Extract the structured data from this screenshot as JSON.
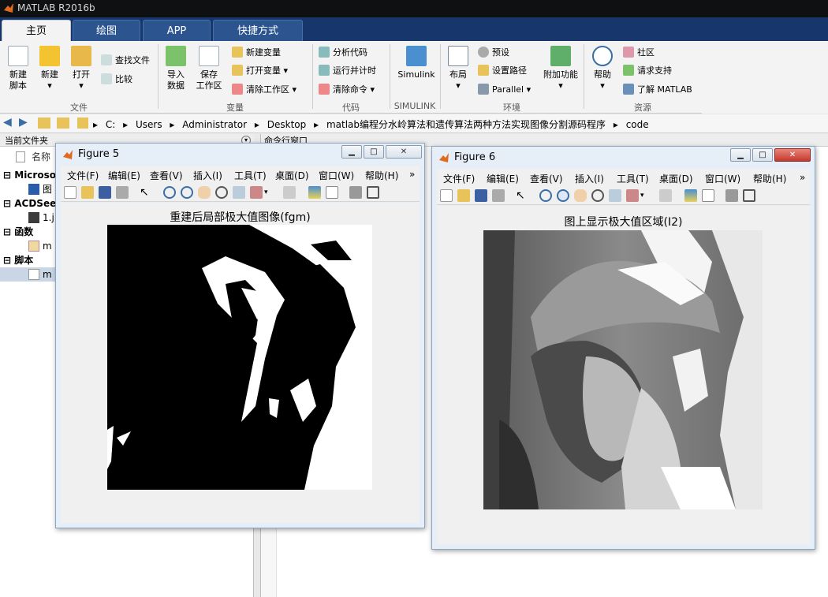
{
  "app": {
    "title": "MATLAB R2016b"
  },
  "tabs": [
    {
      "label": "主页",
      "active": true
    },
    {
      "label": "绘图",
      "active": false
    },
    {
      "label": "APP",
      "active": false
    },
    {
      "label": "快捷方式",
      "active": false
    }
  ],
  "ribbon": {
    "file": {
      "new_script": "新建\n脚本",
      "new": "新建",
      "open": "打开",
      "find_files": "查找文件",
      "compare": "比较",
      "group": "文件"
    },
    "variable": {
      "import": "导入\n数据",
      "save_ws": "保存\n工作区",
      "new_var": "新建变量",
      "open_var": "打开变量",
      "clear_ws": "清除工作区",
      "group": "变量"
    },
    "code": {
      "analyze": "分析代码",
      "run_time": "运行并计时",
      "clear_cmd": "清除命令",
      "group": "代码"
    },
    "simulink": {
      "label": "Simulink",
      "group": "SIMULINK"
    },
    "env": {
      "layout": "布局",
      "prefs": "预设",
      "set_path": "设置路径",
      "parallel": "Parallel",
      "addons": "附加功能",
      "group": "环境"
    },
    "resources": {
      "help": "帮助",
      "community": "社区",
      "support": "请求支持",
      "learn": "了解 MATLAB",
      "group": "资源"
    }
  },
  "address": {
    "crumbs": [
      "C:",
      "Users",
      "Administrator",
      "Desktop",
      "matlab编程分水岭算法和遗传算法两种方法实现图像分割源码程序",
      "code"
    ]
  },
  "left_panel": {
    "title": "当前文件夹",
    "column": "名称",
    "items": [
      {
        "label": "Microso",
        "kind": "group"
      },
      {
        "label": "图",
        "kind": "file"
      },
      {
        "label": "ACDSee",
        "kind": "group"
      },
      {
        "label": "1.j",
        "kind": "file"
      },
      {
        "label": "函数",
        "kind": "group"
      },
      {
        "label": "m",
        "kind": "file"
      },
      {
        "label": "脚本",
        "kind": "group"
      },
      {
        "label": "m",
        "kind": "file"
      }
    ]
  },
  "command_window": {
    "title": "命令行窗口"
  },
  "fig_menu": [
    "文件(F)",
    "编辑(E)",
    "查看(V)",
    "插入(I)",
    "工具(T)",
    "桌面(D)",
    "窗口(W)",
    "帮助(H)"
  ],
  "figure5": {
    "title": "Figure 5",
    "plot_title": "重建后局部极大值图像(fgm)"
  },
  "figure6": {
    "title": "Figure 6",
    "plot_title": "图上显示极大值区域(I2)"
  }
}
